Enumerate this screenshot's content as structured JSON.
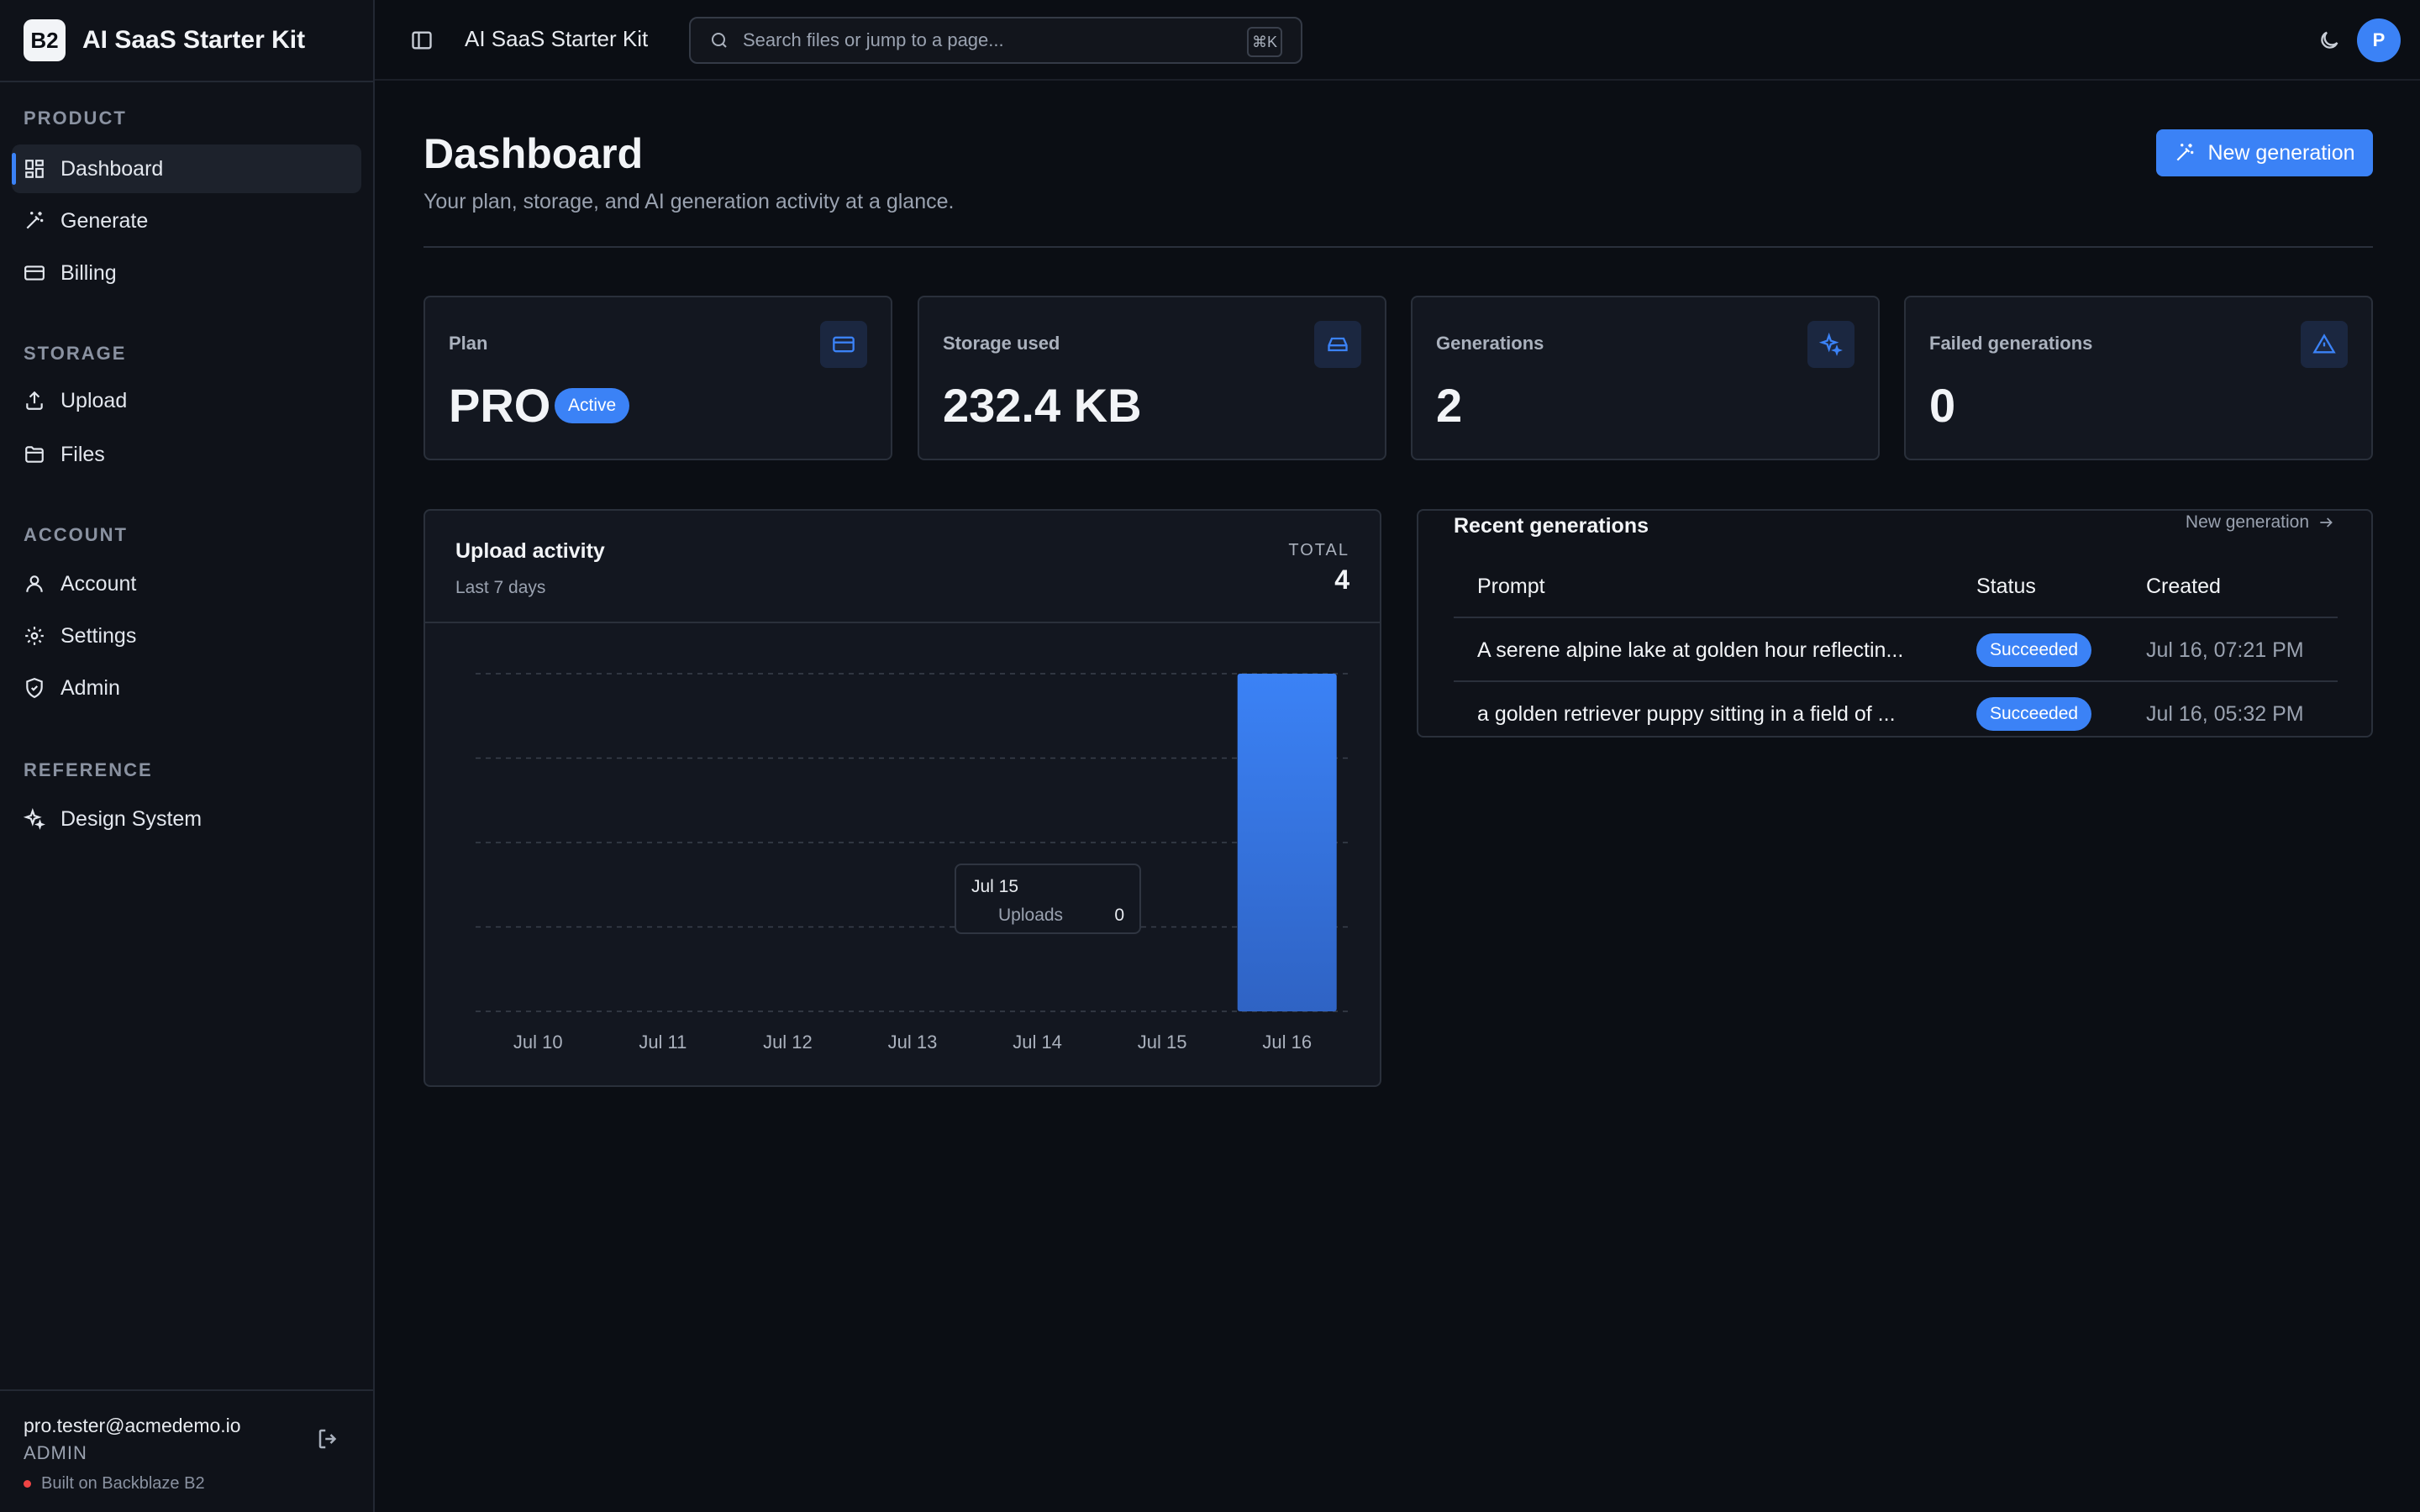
{
  "brand": {
    "logo": "B2",
    "name": "AI SaaS Starter Kit"
  },
  "sidebar": {
    "sections": [
      {
        "heading": "PRODUCT",
        "items": [
          {
            "label": "Dashboard",
            "icon": "dashboard-icon",
            "active": true
          },
          {
            "label": "Generate",
            "icon": "magic-wand-icon"
          },
          {
            "label": "Billing",
            "icon": "credit-card-icon"
          }
        ]
      },
      {
        "heading": "STORAGE",
        "items": [
          {
            "label": "Upload",
            "icon": "upload-icon"
          },
          {
            "label": "Files",
            "icon": "folder-icon"
          }
        ]
      },
      {
        "heading": "ACCOUNT",
        "items": [
          {
            "label": "Account",
            "icon": "user-icon"
          },
          {
            "label": "Settings",
            "icon": "gear-icon"
          },
          {
            "label": "Admin",
            "icon": "shield-icon"
          }
        ]
      },
      {
        "heading": "REFERENCE",
        "items": [
          {
            "label": "Design System",
            "icon": "sparkles-icon"
          }
        ]
      }
    ],
    "user": {
      "email": "pro.tester@acmedemo.io",
      "role": "ADMIN"
    },
    "footer_note": "Built on Backblaze B2"
  },
  "topbar": {
    "title": "AI SaaS Starter Kit",
    "search_placeholder": "Search files or jump to a page...",
    "shortcut": "⌘K",
    "avatar_initial": "P"
  },
  "page": {
    "title": "Dashboard",
    "subtitle": "Your plan, storage, and AI generation activity at a glance.",
    "primary_action": "New generation"
  },
  "stats": [
    {
      "label": "Plan",
      "value": "PRO",
      "badge": "Active",
      "icon": "credit-card-icon"
    },
    {
      "label": "Storage used",
      "value": "232.4 KB",
      "icon": "hard-drive-icon"
    },
    {
      "label": "Generations",
      "value": "2",
      "icon": "sparkles-icon"
    },
    {
      "label": "Failed generations",
      "value": "0",
      "icon": "warning-icon"
    }
  ],
  "upload_activity": {
    "title": "Upload activity",
    "subtitle": "Last 7 days",
    "total_label": "TOTAL",
    "total_value": "4",
    "tooltip": {
      "date": "Jul 15",
      "series": "Uploads",
      "value": "0"
    }
  },
  "chart_data": {
    "type": "bar",
    "categories": [
      "Jul 10",
      "Jul 11",
      "Jul 12",
      "Jul 13",
      "Jul 14",
      "Jul 15",
      "Jul 16"
    ],
    "series": [
      {
        "name": "Uploads",
        "values": [
          0,
          0,
          0,
          0,
          0,
          0,
          4
        ]
      }
    ],
    "ylim": [
      0,
      4
    ],
    "grid": true,
    "bar_color": "#3b82f6"
  },
  "recent_generations": {
    "title": "Recent generations",
    "link": "New generation",
    "columns": [
      "Prompt",
      "Status",
      "Created"
    ],
    "rows": [
      {
        "prompt": "A serene alpine lake at golden hour reflectin...",
        "status": "Succeeded",
        "created": "Jul 16, 07:21 PM"
      },
      {
        "prompt": "a golden retriever puppy sitting in a field of ...",
        "status": "Succeeded",
        "created": "Jul 16, 05:32 PM"
      }
    ]
  },
  "colors": {
    "accent": "#3b82f6",
    "background": "#0b0e14",
    "danger": "#ef4444"
  }
}
